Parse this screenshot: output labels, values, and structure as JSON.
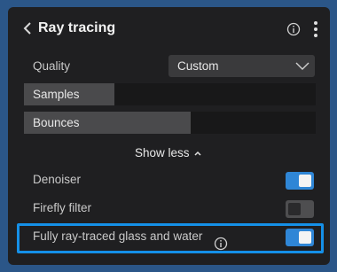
{
  "header": {
    "title": "Ray tracing"
  },
  "quality": {
    "label": "Quality",
    "value": "Custom"
  },
  "sliders": [
    {
      "label": "Samples",
      "level": 0.31
    },
    {
      "label": "Bounces",
      "level": 0.57
    }
  ],
  "show_less": {
    "label": "Show less"
  },
  "toggles": [
    {
      "label": "Denoiser",
      "on": true
    },
    {
      "label": "Firefly filter",
      "on": false
    },
    {
      "label": "Fully ray-traced glass and water",
      "on": true
    }
  ],
  "colors": {
    "accent": "#2f86d6",
    "highlight": "#1590e8",
    "panel": "#1f1f21",
    "backdrop": "#2b5688"
  },
  "icons": [
    "back-chevron-icon",
    "info-icon",
    "more-vertical-icon",
    "chevron-down-icon",
    "caret-up-icon"
  ]
}
